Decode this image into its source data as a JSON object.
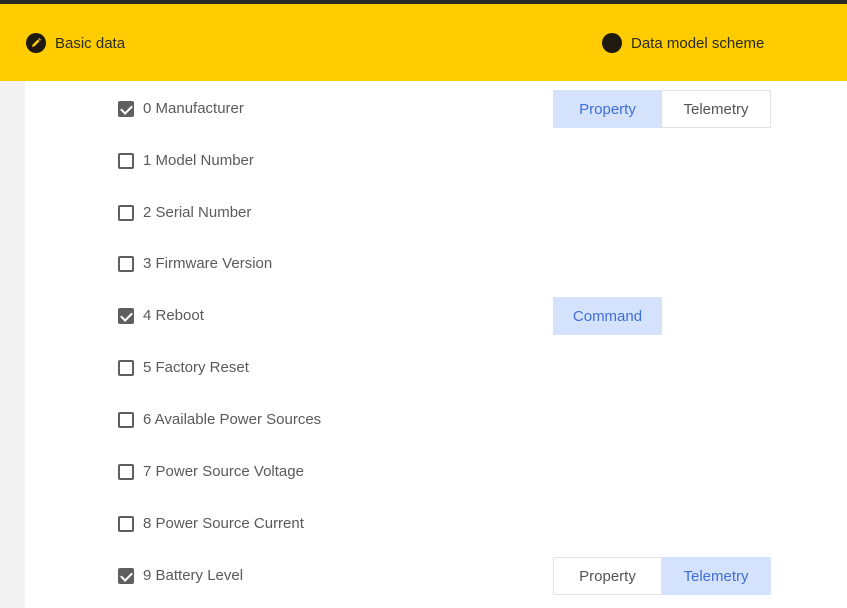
{
  "header": {
    "steps": [
      {
        "label": "Basic data",
        "icon": "pencil-icon"
      },
      {
        "label": "Data model scheme",
        "icon": "filled-circle-icon"
      }
    ],
    "background": "#ffcc00"
  },
  "items": [
    {
      "label": "0 Manufacturer",
      "checked": true,
      "toggle": [
        "Property",
        "Telemetry"
      ],
      "active": "Property"
    },
    {
      "label": "1 Model Number",
      "checked": false
    },
    {
      "label": "2 Serial Number",
      "checked": false
    },
    {
      "label": "3 Firmware Version",
      "checked": false
    },
    {
      "label": "4 Reboot",
      "checked": true,
      "toggle": [
        "Command"
      ],
      "active": "Command"
    },
    {
      "label": "5 Factory Reset",
      "checked": false
    },
    {
      "label": "6 Available Power Sources",
      "checked": false
    },
    {
      "label": "7 Power Source Voltage",
      "checked": false
    },
    {
      "label": "8 Power Source Current",
      "checked": false
    },
    {
      "label": "9 Battery Level",
      "checked": true,
      "toggle": [
        "Property",
        "Telemetry"
      ],
      "active": "Telemetry"
    }
  ],
  "colors": {
    "accent": "#3f6fd9",
    "active_bg": "#d5e2fb",
    "checkbox": "#5f5f5f"
  }
}
